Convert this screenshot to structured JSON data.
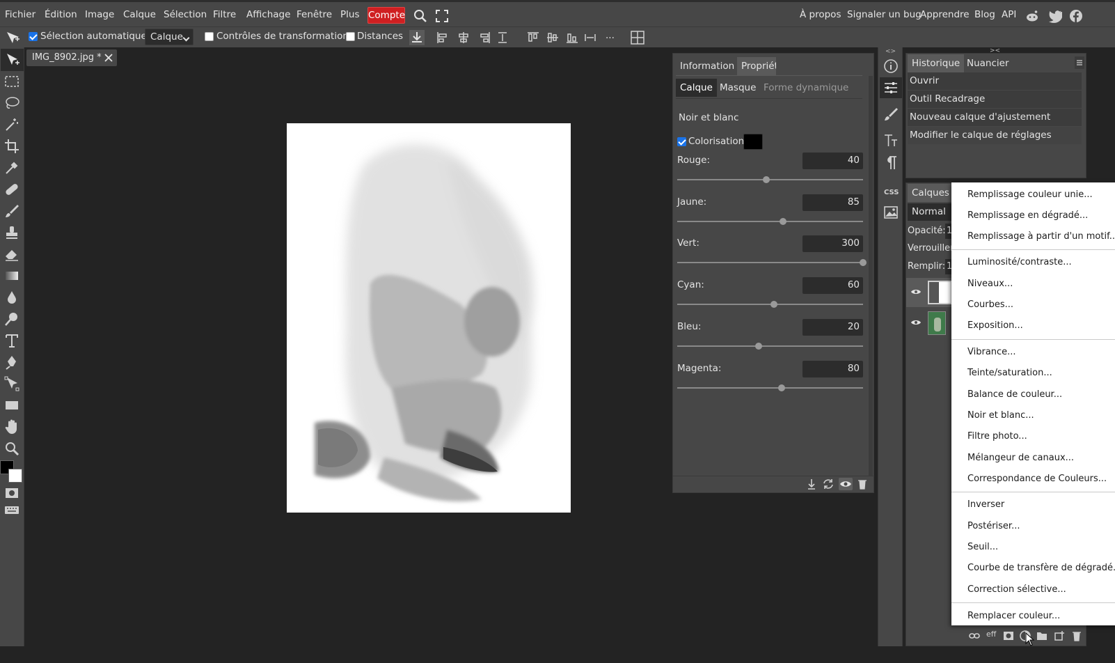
{
  "menu": {
    "items": [
      "Fichier",
      "Édition",
      "Image",
      "Calque",
      "Sélection",
      "Filtre",
      "Affichage",
      "Fenêtre",
      "Plus"
    ],
    "account": "Compte",
    "right_links": [
      "À propos",
      "Signaler un bug",
      "Apprendre",
      "Blog",
      "API"
    ]
  },
  "options": {
    "auto_select_label": "Sélection automatique",
    "auto_select_checked": true,
    "target_value": "Calque",
    "transform_label": "Contrôles de transformation",
    "distances_label": "Distances",
    "more_label": "..."
  },
  "document": {
    "tab_title": "IMG_8902.jpg *"
  },
  "properties": {
    "tabs": [
      "Information",
      "Propriétés"
    ],
    "subtabs": [
      "Calque",
      "Masque",
      "Forme dynamique"
    ],
    "adjustment_title": "Noir et blanc",
    "colorize_label": "Colorisation",
    "colorize_checked": true,
    "colorize_color": "#000000",
    "sliders": [
      {
        "label": "Rouge:",
        "value": "40",
        "fraction": 0.48
      },
      {
        "label": "Jaune:",
        "value": "85",
        "fraction": 0.57
      },
      {
        "label": "Vert:",
        "value": "300",
        "fraction": 1.0
      },
      {
        "label": "Cyan:",
        "value": "60",
        "fraction": 0.52
      },
      {
        "label": "Bleu:",
        "value": "20",
        "fraction": 0.44
      },
      {
        "label": "Magenta:",
        "value": "80",
        "fraction": 0.56
      }
    ]
  },
  "history": {
    "tabs": [
      "Historique",
      "Nuancier"
    ],
    "entries": [
      "Ouvrir",
      "Outil Recadrage",
      "Nouveau calque d'ajustement",
      "Modifier le calque de réglages"
    ]
  },
  "layers": {
    "tab": "Calques",
    "blend_mode": "Normal",
    "opacity_label": "Opacité:",
    "opacity_value": "1",
    "lock_label": "Verrouiller",
    "fill_label": "Remplir:",
    "fill_value": "1"
  },
  "adjustment_menu": {
    "items": [
      "Remplissage couleur unie...",
      "Remplissage en dégradé...",
      "Remplissage à partir d'un motif...",
      "Luminosité/contraste...",
      "Niveaux...",
      "Courbes...",
      "Exposition...",
      "Vibrance...",
      "Teinte/saturation...",
      "Balance de couleur...",
      "Noir et blanc...",
      "Filtre photo...",
      "Mélangeur de canaux...",
      "Correspondance de Couleurs...",
      "Inverser",
      "Postériser...",
      "Seuil...",
      "Courbe de transfère de dégradé...",
      "Correction sélective...",
      "Remplacer couleur..."
    ]
  },
  "colors": {
    "account_red": "#cf1f21",
    "panel_bg": "#474747",
    "workspace_bg": "#232323",
    "foreground": "#000000",
    "background": "#ffffff"
  }
}
